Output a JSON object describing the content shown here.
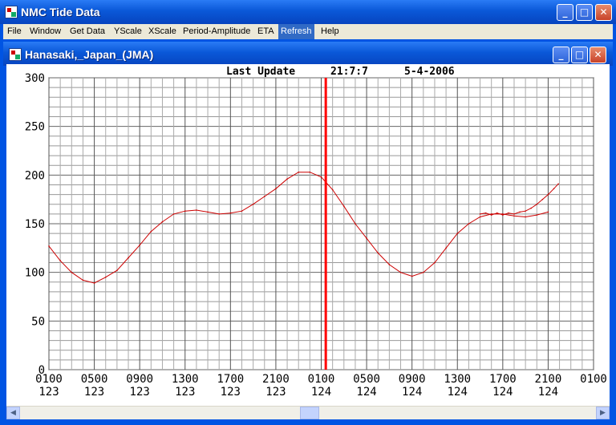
{
  "window": {
    "title": "NMC Tide Data"
  },
  "menu": [
    "File",
    "Window",
    "Get Data",
    "YScale",
    "XScale",
    "Period-Amplitude",
    "ETA",
    "Refresh",
    "Help"
  ],
  "menu_active": "Refresh",
  "child_window": {
    "title": "Hanasaki,_Japan_(JMA)"
  },
  "plot": {
    "update_label": "Last Update",
    "update_time": "21:7:7",
    "update_date": "5-4-2006"
  },
  "chart_data": {
    "type": "line",
    "title": "Last Update  21:7:7   5-4-2006",
    "ylim": [
      0,
      300
    ],
    "yticks": [
      0,
      50,
      100,
      150,
      200,
      250,
      300
    ],
    "x_tick_labels": [
      [
        "0100",
        "123"
      ],
      [
        "0500",
        "123"
      ],
      [
        "0900",
        "123"
      ],
      [
        "1300",
        "123"
      ],
      [
        "1700",
        "123"
      ],
      [
        "2100",
        "123"
      ],
      [
        "0100",
        "124"
      ],
      [
        "0500",
        "124"
      ],
      [
        "0900",
        "124"
      ],
      [
        "1300",
        "124"
      ],
      [
        "1700",
        "124"
      ],
      [
        "2100",
        "124"
      ],
      [
        "0100",
        ""
      ]
    ],
    "x_hours_range": [
      0,
      48
    ],
    "current_time_hour": 24.4,
    "series": [
      {
        "color": "#CC0000",
        "x": [
          0,
          1,
          2,
          3,
          4,
          5,
          6,
          7,
          8,
          9,
          10,
          11,
          12,
          13,
          14,
          15,
          16,
          17,
          18,
          19,
          20,
          21,
          22,
          23,
          24,
          25,
          26,
          27,
          28,
          29,
          30,
          31,
          32,
          33,
          34,
          35,
          36,
          37,
          38,
          39,
          40,
          41,
          42,
          43,
          44
        ],
        "y": [
          127,
          112,
          100,
          92,
          89,
          95,
          102,
          115,
          128,
          142,
          152,
          160,
          163,
          164,
          162,
          160,
          161,
          163,
          170,
          178,
          186,
          196,
          203,
          203,
          198,
          185,
          168,
          150,
          135,
          120,
          108,
          100,
          96,
          100,
          110,
          125,
          140,
          150,
          157,
          160,
          160,
          158,
          157,
          159,
          162
        ]
      },
      {
        "color": "#CC0000",
        "x": [
          38,
          38.5,
          39,
          39.5,
          40,
          40.5,
          41,
          41.5,
          42,
          42.5,
          43,
          43.5,
          44,
          44.5,
          44.9
        ],
        "y": [
          160,
          161,
          159,
          161,
          159,
          161,
          160,
          162,
          163,
          166,
          170,
          175,
          180,
          186,
          191
        ]
      }
    ],
    "current_time_color": "#FF0000",
    "grid": "on"
  }
}
